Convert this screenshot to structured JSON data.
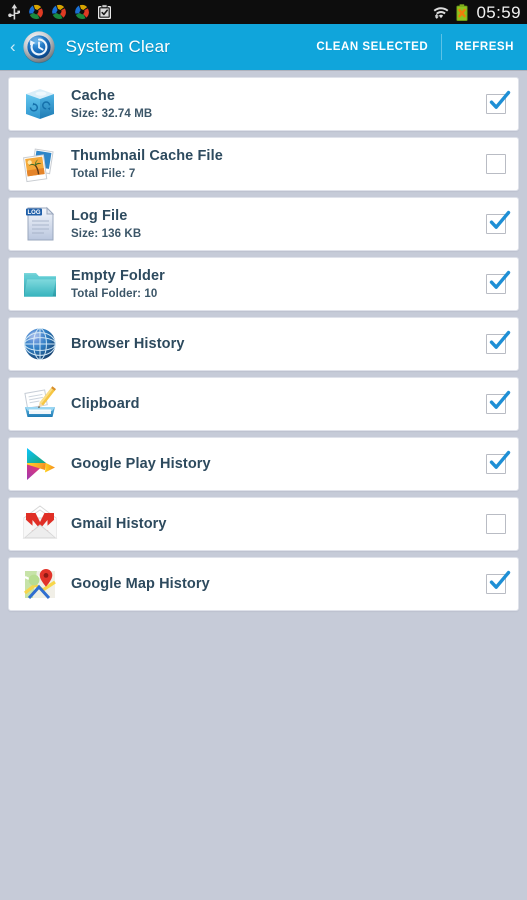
{
  "statusbar": {
    "time": "05:59",
    "left_icons": [
      "usb-icon",
      "sync-app-icon",
      "sync-app-icon",
      "sync-app-icon",
      "clipboard-icon"
    ],
    "right_icons": [
      "wifi-icon",
      "battery-icon"
    ]
  },
  "actionbar": {
    "back_glyph": "‹",
    "app_icon": "system-clear-icon",
    "title": "System Clear",
    "clean_selected_label": "CLEAN SELECTED",
    "refresh_label": "REFRESH",
    "background_color": "#10a5db"
  },
  "colors": {
    "accent": "#10a5db",
    "page_background": "#c6cbd8",
    "card_background": "#ffffff",
    "title_text": "#2d4a5e",
    "checkbox_check": "#1e8fd5"
  },
  "list": {
    "items": [
      {
        "icon": "cache-bin-icon",
        "title": "Cache",
        "subtitle": "Size: 32.74 MB",
        "checked": true
      },
      {
        "icon": "thumbnail-photos-icon",
        "title": "Thumbnail Cache File",
        "subtitle": "Total File: 7",
        "checked": false
      },
      {
        "icon": "log-file-icon",
        "title": "Log File",
        "subtitle": "Size: 136 KB",
        "checked": true
      },
      {
        "icon": "empty-folder-icon",
        "title": "Empty Folder",
        "subtitle": "Total Folder: 10",
        "checked": true
      },
      {
        "icon": "browser-globe-icon",
        "title": "Browser History",
        "subtitle": "",
        "checked": true
      },
      {
        "icon": "clipboard-tray-icon",
        "title": "Clipboard",
        "subtitle": "",
        "checked": true
      },
      {
        "icon": "google-play-icon",
        "title": "Google Play History",
        "subtitle": "",
        "checked": true
      },
      {
        "icon": "gmail-icon",
        "title": "Gmail History",
        "subtitle": "",
        "checked": false
      },
      {
        "icon": "google-maps-icon",
        "title": "Google Map History",
        "subtitle": "",
        "checked": true
      }
    ]
  }
}
